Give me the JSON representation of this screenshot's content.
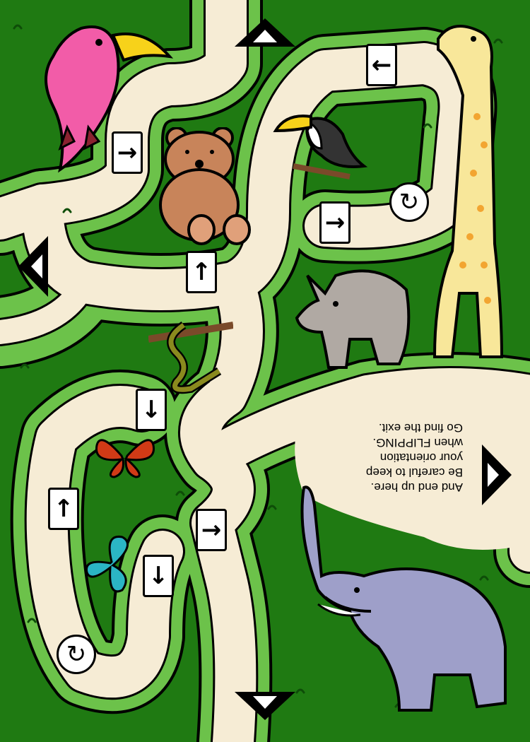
{
  "message": {
    "lines": [
      "And end up here.",
      "Be careful to keep",
      "your orientation",
      "when FLIPPING.",
      "Go find the exit."
    ]
  },
  "signs": {
    "arrows": [
      {
        "name": "arrow-left-top",
        "glyph": "←"
      },
      {
        "name": "arrow-right-parrot",
        "glyph": "→"
      },
      {
        "name": "arrow-right-toucan",
        "glyph": "→"
      },
      {
        "name": "arrow-up-bear",
        "glyph": "↑"
      },
      {
        "name": "arrow-down-snake",
        "glyph": "↓"
      },
      {
        "name": "arrow-up-left",
        "glyph": "↑"
      },
      {
        "name": "arrow-down-butterfly",
        "glyph": "↓"
      },
      {
        "name": "arrow-right-bottom",
        "glyph": "→"
      }
    ],
    "flip": "↻"
  },
  "colors": {
    "dark_green": "#1f7a12",
    "light_green": "#6cc24a",
    "path": "#f6ecd5"
  }
}
